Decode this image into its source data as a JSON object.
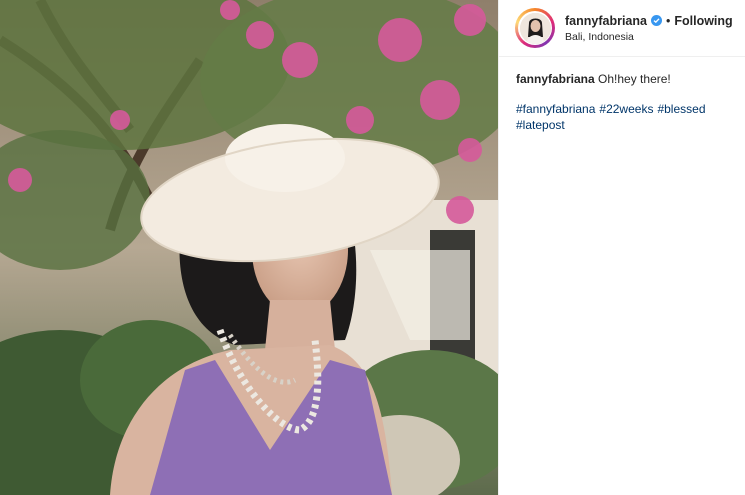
{
  "post": {
    "username": "fannyfabriana",
    "separator": "•",
    "follow_status": "Following",
    "location": "Bali, Indonesia"
  },
  "caption": {
    "username": "fannyfabriana",
    "text": "Oh!hey there!",
    "hashtags": [
      "#fannyfabriana",
      "#22weeks",
      "#blessed",
      "#latepost"
    ]
  },
  "colors": {
    "link": "#003569",
    "verified": "#3897f0",
    "dress": "#8e6fb5",
    "hat": "#f3ebe0"
  },
  "icons": {
    "verified": "verified-badge-icon"
  }
}
